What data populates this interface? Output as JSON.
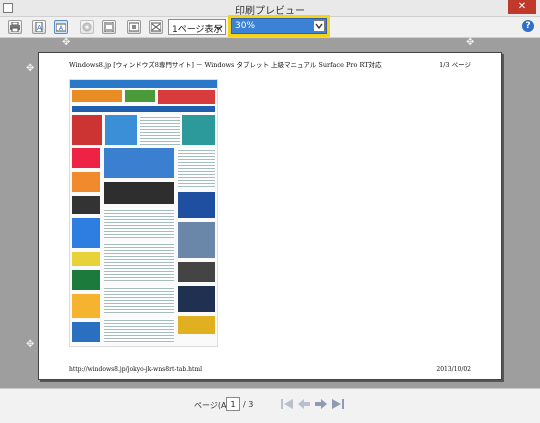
{
  "window": {
    "title": "印刷プレビュー",
    "close_label": "✕"
  },
  "toolbar": {
    "page_mode": "1ページ表示",
    "zoom": "30%",
    "help_label": "?"
  },
  "page": {
    "header_left": "Windows8.jp [ウィンドウズ8専門サイト] －  Windows タブレット 上級マニュアル  Surface Pro RT対応",
    "header_right": "1/3 ページ",
    "footer_left": "http://windows8.jp/jokyo-jk-wns8rt-tab.html",
    "footer_right": "2013/10/02"
  },
  "statusbar": {
    "page_label": "ページ(A)",
    "current_page": "1",
    "total_pages": "/ 3"
  },
  "colors": {
    "zoom_highlight": "#f2d21a",
    "zoom_selected": "#3b82d6",
    "close": "#c0392b"
  }
}
